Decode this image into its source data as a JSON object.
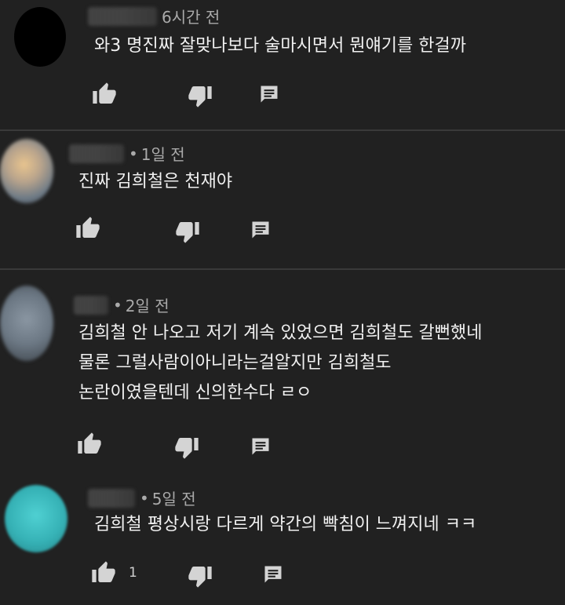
{
  "comments": [
    {
      "time": "6시간 전",
      "text": [
        "와3 명진짜 잘맞나보다 술마시면서 뭔얘기를 한걸까"
      ],
      "likes": ""
    },
    {
      "time": "1일 전",
      "text": [
        "진짜 김희철은 천재야"
      ],
      "likes": ""
    },
    {
      "time": "2일 전",
      "text": [
        "김희철 안 나오고 저기 계속 있었으면 김희철도 갈뻔했네",
        "물론 그럴사람이아니라는걸알지만 김희철도",
        "논란이였을텐데 신의한수다 ㄹㅇ"
      ],
      "likes": ""
    },
    {
      "time": "5일 전",
      "text": [
        "김희철 평상시랑 다르게 약간의 빡침이 느껴지네 ㅋㅋ"
      ],
      "likes": "1"
    }
  ],
  "separator": "•",
  "icons": {
    "like": "thumb-up-icon",
    "dislike": "thumb-down-icon",
    "reply": "reply-icon"
  },
  "colors": {
    "background": "#212121",
    "text": "#f1f1f1",
    "meta": "#aaaaaa",
    "icon": "#d4d4d4",
    "divider": "#3a3a3a"
  }
}
